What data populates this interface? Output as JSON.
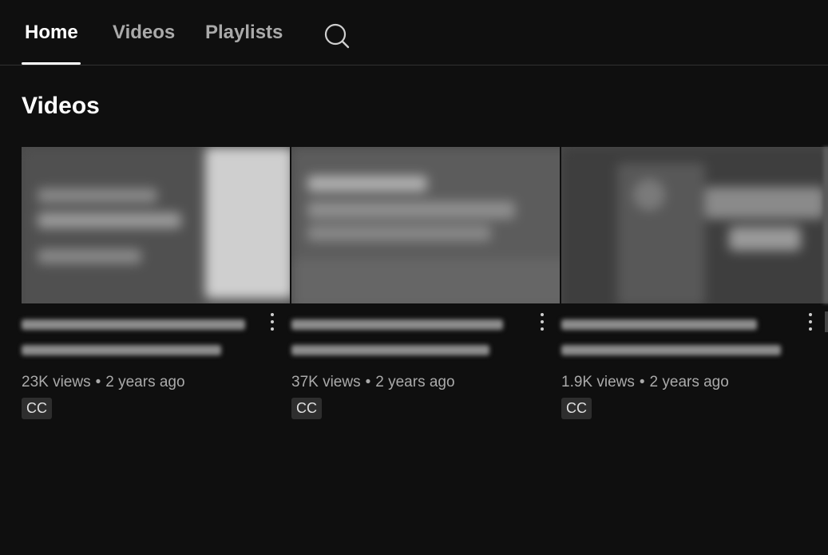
{
  "tabs": [
    {
      "label": "Home",
      "active": true
    },
    {
      "label": "Videos",
      "active": false
    },
    {
      "label": "Playlists",
      "active": false
    }
  ],
  "search": {
    "icon": "search-icon"
  },
  "section": {
    "title": "Videos"
  },
  "videos": [
    {
      "title": "",
      "views": "23K views",
      "age": "2 years ago",
      "badge": "CC"
    },
    {
      "title": "",
      "views": "37K views",
      "age": "2 years ago",
      "badge": "CC"
    },
    {
      "title": "",
      "views": "1.9K views",
      "age": "2 years ago",
      "badge": "CC"
    }
  ],
  "meta_separator": "•",
  "colors": {
    "background": "#0f0f0f",
    "active_tab": "#ffffff",
    "inactive_tab": "#aaaaaa",
    "meta_text": "#aaaaaa",
    "badge_bg": "#2e2e2e"
  }
}
